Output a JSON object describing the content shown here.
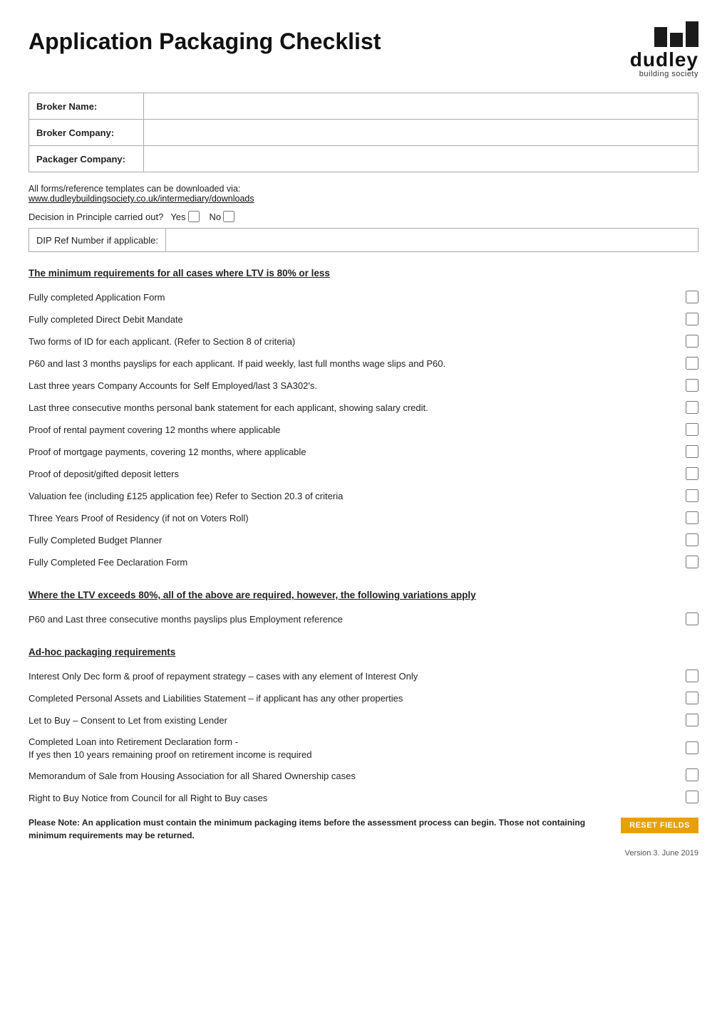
{
  "header": {
    "title": "Application Packaging Checklist",
    "logo": {
      "text_main": "dudley",
      "text_sub": "building society"
    }
  },
  "form_fields": {
    "broker_name_label": "Broker Name:",
    "broker_company_label": "Broker Company:",
    "packager_company_label": "Packager Company:"
  },
  "info": {
    "line1": "All forms/reference templates can be downloaded via:",
    "link_text": "www.dudleybuildingsociety.co.uk/intermediary/downloads",
    "dip_question": "Decision in Principle carried out?",
    "yes_label": "Yes",
    "no_label": "No",
    "dip_ref_label": "DIP Ref Number if applicable:"
  },
  "sections": {
    "section1_heading": "The minimum requirements for all cases where LTV is 80% or less",
    "section1_items": [
      "Fully completed Application Form",
      "Fully completed Direct Debit Mandate",
      "Two forms of ID for each applicant. (Refer to Section 8 of criteria)",
      "P60 and last 3 months payslips for each applicant. If paid weekly, last full months wage slips and P60.",
      "Last three years Company Accounts for Self Employed/last 3 SA302's.",
      "Last three consecutive months personal bank statement for each applicant, showing salary credit.",
      "Proof of rental payment covering 12 months where applicable",
      "Proof of mortgage payments, covering 12 months, where applicable",
      "Proof of deposit/gifted deposit letters",
      "Valuation fee (including £125 application fee) Refer to Section 20.3 of criteria",
      "Three Years Proof of Residency (if not on Voters Roll)",
      "Fully Completed Budget Planner",
      "Fully Completed Fee Declaration Form"
    ],
    "section2_heading": "Where the LTV exceeds 80%, all of the above are required, however, the following variations apply",
    "section2_items": [
      "P60 and Last three consecutive months payslips plus Employment reference"
    ],
    "section3_heading": "Ad-hoc packaging requirements",
    "section3_items": [
      "Interest Only Dec form & proof of repayment strategy – cases with any element of Interest Only",
      "Completed Personal Assets and Liabilities Statement – if applicant has any other properties",
      "Let to Buy – Consent to Let from existing Lender",
      "Completed Loan into Retirement Declaration form -\nIf yes then 10 years remaining proof on retirement income is required",
      "Memorandum of Sale from Housing Association for all Shared Ownership cases",
      "Right to Buy Notice from Council for all Right to Buy cases"
    ]
  },
  "buttons": {
    "reset_label": "RESET FIELDS"
  },
  "footer": {
    "note": "Please Note: An application must contain the minimum packaging items before the assessment process can begin.\nThose not containing minimum requirements may be returned.",
    "version": "Version 3. June 2019"
  }
}
